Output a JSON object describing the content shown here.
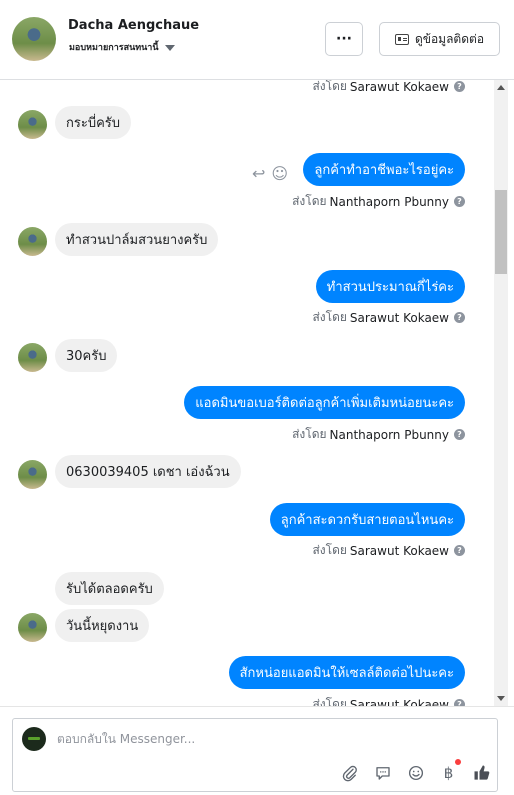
{
  "header": {
    "name": "Dacha Aengchaue",
    "subtitle": "มอบหมายการสนทนานี้",
    "more_label": "···",
    "profile_label": "ดูข้อมูลติดต่อ"
  },
  "thread": {
    "sent_prefix": "ส่งโดย",
    "top_sender": "Sarawut Kokaew",
    "messages": [
      {
        "dir": "in",
        "text": "กระบี่ครับ"
      },
      {
        "dir": "out",
        "text": "ลูกค้าทำอาชีพอะไรอยู่คะ",
        "sender": "Nanthaporn Pbunny"
      },
      {
        "dir": "in",
        "text": "ทำสวนปาล์มสวนยางครับ"
      },
      {
        "dir": "out",
        "text": "ทำสวนประมาณกี่ไร่คะ",
        "sender": "Sarawut Kokaew"
      },
      {
        "dir": "in",
        "text": "30ครับ"
      },
      {
        "dir": "out",
        "text": "แอดมินขอเบอร์ติดต่อลูกค้าเพิ่มเติมหน่อยนะคะ",
        "sender": "Nanthaporn Pbunny"
      },
      {
        "dir": "in",
        "text": "0630039405 เดชา เอ่งฉ้วน"
      },
      {
        "dir": "out",
        "text": "ลูกค้าสะดวกรับสายตอนไหนคะ",
        "sender": "Sarawut Kokaew"
      },
      {
        "dir": "in",
        "text": "รับได้ตลอดครับ"
      },
      {
        "dir": "in",
        "text": "วันนี้หยุดงาน"
      },
      {
        "dir": "out",
        "text": "สักหน่อยแอดมินให้เซลล์ติดต่อไปนะคะ",
        "sender": "Sarawut Kokaew"
      }
    ]
  },
  "composer": {
    "placeholder": "ตอบกลับใน Messenger..."
  },
  "icons": {
    "attach": "paperclip-icon",
    "saved_replies": "chat-bubble-icon",
    "emoji": "emoji-icon",
    "payment": "baht-icon",
    "like": "thumbs-up-icon"
  }
}
